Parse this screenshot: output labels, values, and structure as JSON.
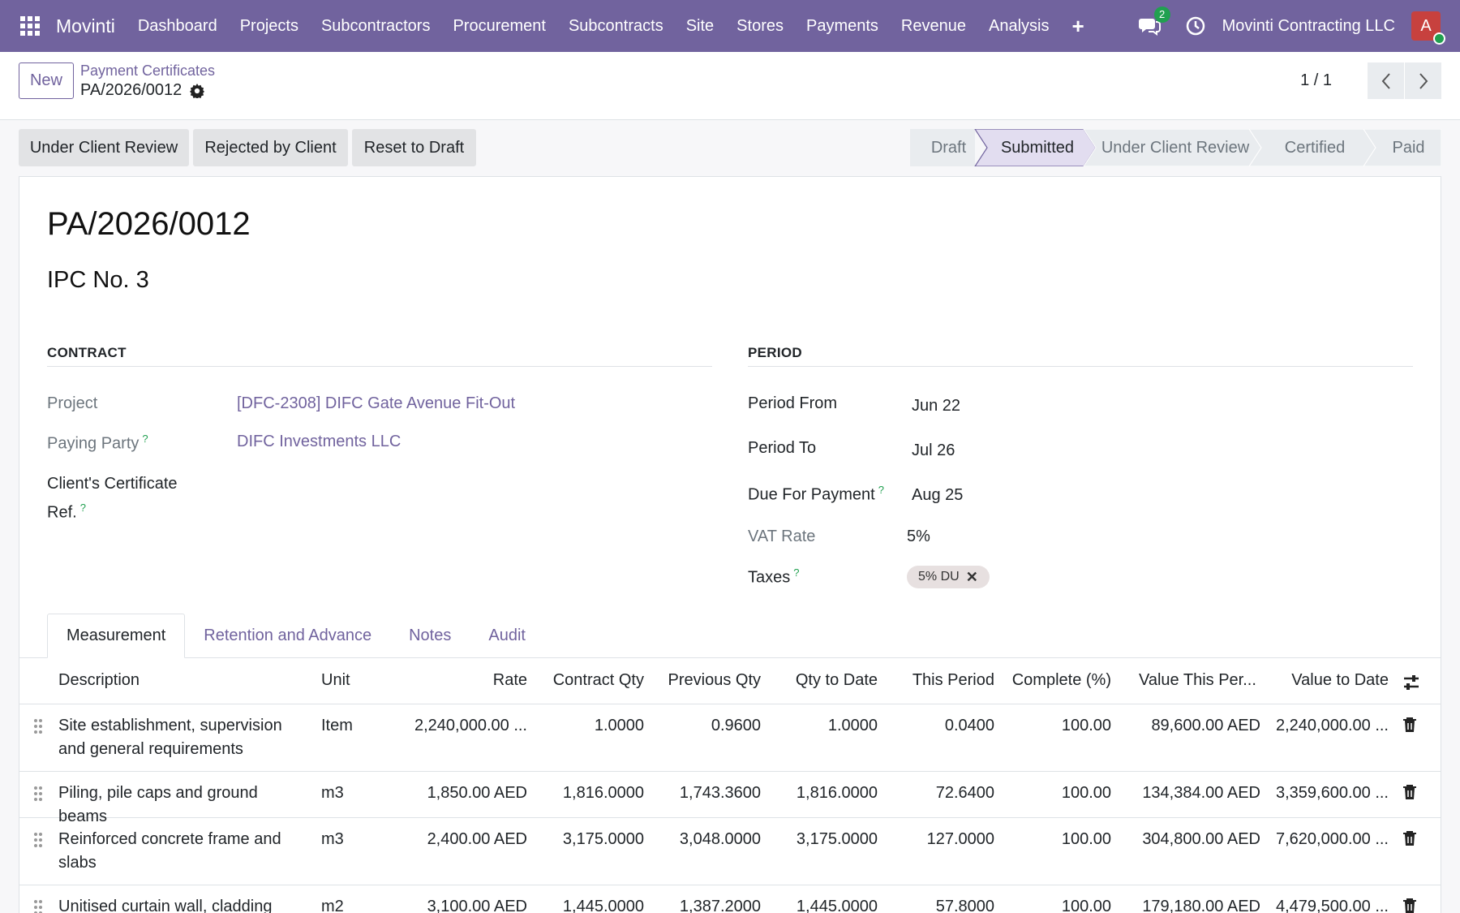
{
  "nav": {
    "brand": "Movinti",
    "menu": [
      "Dashboard",
      "Projects",
      "Subcontractors",
      "Procurement",
      "Subcontracts",
      "Site",
      "Stores",
      "Payments",
      "Revenue",
      "Analysis"
    ],
    "chat_count": "2",
    "company": "Movinti Contracting LLC",
    "avatar_initial": "A"
  },
  "control": {
    "new_label": "New",
    "breadcrumb": "Payment Certificates",
    "record_name": "PA/2026/0012",
    "pager": "1 / 1"
  },
  "actions": [
    "Under Client Review",
    "Rejected by Client",
    "Reset to Draft"
  ],
  "stages": {
    "items": [
      "Draft",
      "Submitted",
      "Under Client Review",
      "Certified",
      "Paid"
    ],
    "current": "Submitted"
  },
  "form": {
    "title": "PA/2026/0012",
    "subtitle": "IPC No. 3",
    "contract": {
      "heading": "Contract",
      "project_label": "Project",
      "project": "[DFC-2308] DIFC Gate Avenue Fit-Out",
      "paying_party_label": "Paying Party",
      "paying_party": "DIFC Investments LLC",
      "client_cert_label_1": "Client's Certificate",
      "client_cert_label_2": "Ref.",
      "client_cert_value": ""
    },
    "period": {
      "heading": "Period",
      "from_label": "Period From",
      "from": "Jun 22",
      "to_label": "Period To",
      "to": "Jul 26",
      "due_label": "Due For Payment",
      "due": "Aug 25",
      "vat_label": "VAT Rate",
      "vat": "5%",
      "taxes_label": "Taxes",
      "tax_tag": "5% DU"
    }
  },
  "tabs": [
    "Measurement",
    "Retention and Advance",
    "Notes",
    "Audit"
  ],
  "table": {
    "headers": [
      "Description",
      "Unit",
      "Rate",
      "Contract Qty",
      "Previous Qty",
      "Qty to Date",
      "This Period",
      "Complete (%)",
      "Value This Per...",
      "Value to Date"
    ],
    "rows": [
      {
        "description": "Site establishment, supervision and general requirements",
        "unit": "Item",
        "rate": "2,240,000.00 ...",
        "contract_qty": "1.0000",
        "previous_qty": "0.9600",
        "qty_to_date": "1.0000",
        "this_period": "0.0400",
        "complete": "100.00",
        "value_this_period": "89,600.00 AED",
        "value_to_date": "2,240,000.00 ..."
      },
      {
        "description": "Piling, pile caps and ground beams",
        "unit": "m3",
        "rate": "1,850.00 AED",
        "contract_qty": "1,816.0000",
        "previous_qty": "1,743.3600",
        "qty_to_date": "1,816.0000",
        "this_period": "72.6400",
        "complete": "100.00",
        "value_this_period": "134,384.00 AED",
        "value_to_date": "3,359,600.00 ..."
      },
      {
        "description": "Reinforced concrete frame and slabs",
        "unit": "m3",
        "rate": "2,400.00 AED",
        "contract_qty": "3,175.0000",
        "previous_qty": "3,048.0000",
        "qty_to_date": "3,175.0000",
        "this_period": "127.0000",
        "complete": "100.00",
        "value_this_period": "304,800.00 AED",
        "value_to_date": "7,620,000.00 ..."
      },
      {
        "description": "Unitised curtain wall, cladding and",
        "unit": "m2",
        "rate": "3,100.00 AED",
        "contract_qty": "1,445.0000",
        "previous_qty": "1,387.2000",
        "qty_to_date": "1,445.0000",
        "this_period": "57.8000",
        "complete": "100.00",
        "value_this_period": "179,180.00 AED",
        "value_to_date": "4,479,500.00 ..."
      }
    ]
  },
  "colors": {
    "brand": "#71639e",
    "success": "#21a050",
    "avatar": "#c7413e"
  }
}
